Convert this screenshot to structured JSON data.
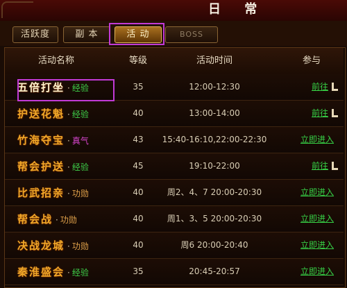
{
  "title": "日 常",
  "tabs": [
    {
      "label": "活跃度"
    },
    {
      "label": "副 本"
    },
    {
      "label": "活 动"
    },
    {
      "label": "BOSS"
    }
  ],
  "headers": {
    "name": "活动名称",
    "level": "等级",
    "time": "活动时间",
    "join": "参与"
  },
  "rows": [
    {
      "name": "五倍打坐",
      "reward": "经验",
      "level": "35",
      "time": "12:00-12:30",
      "action": "前往"
    },
    {
      "name": "护送花魁",
      "reward": "经验",
      "level": "40",
      "time": "13:00-14:00",
      "action": "前往"
    },
    {
      "name": "竹海夺宝",
      "reward": "真气",
      "level": "43",
      "time": "15:40-16:10,22:00-22:30",
      "action": "立即进入"
    },
    {
      "name": "帮会护送",
      "reward": "经验",
      "level": "45",
      "time": "19:10-22:00",
      "action": "前往"
    },
    {
      "name": "比武招亲",
      "reward": "功勋",
      "level": "40",
      "time": "周2、4、7 20:00-20:30",
      "action": "立即进入"
    },
    {
      "name": "帮会战",
      "reward": "功勋",
      "level": "40",
      "time": "周1、3、5 20:00-20:30",
      "action": "立即进入"
    },
    {
      "name": "决战龙城",
      "reward": "功勋",
      "level": "40",
      "time": "周6 20:00-20:40",
      "action": "立即进入"
    },
    {
      "name": "秦淮盛会",
      "reward": "经验",
      "level": "35",
      "time": "20:45-20:57",
      "action": "立即进入"
    }
  ],
  "separator": "·",
  "colors": {
    "reward_exp": "#3fd14a",
    "reward_qi": "#d946d0",
    "reward_merit": "#e0a14a",
    "action_link": "#37d146",
    "activity_name": "#f0a728",
    "highlight": "#c23ad6"
  }
}
